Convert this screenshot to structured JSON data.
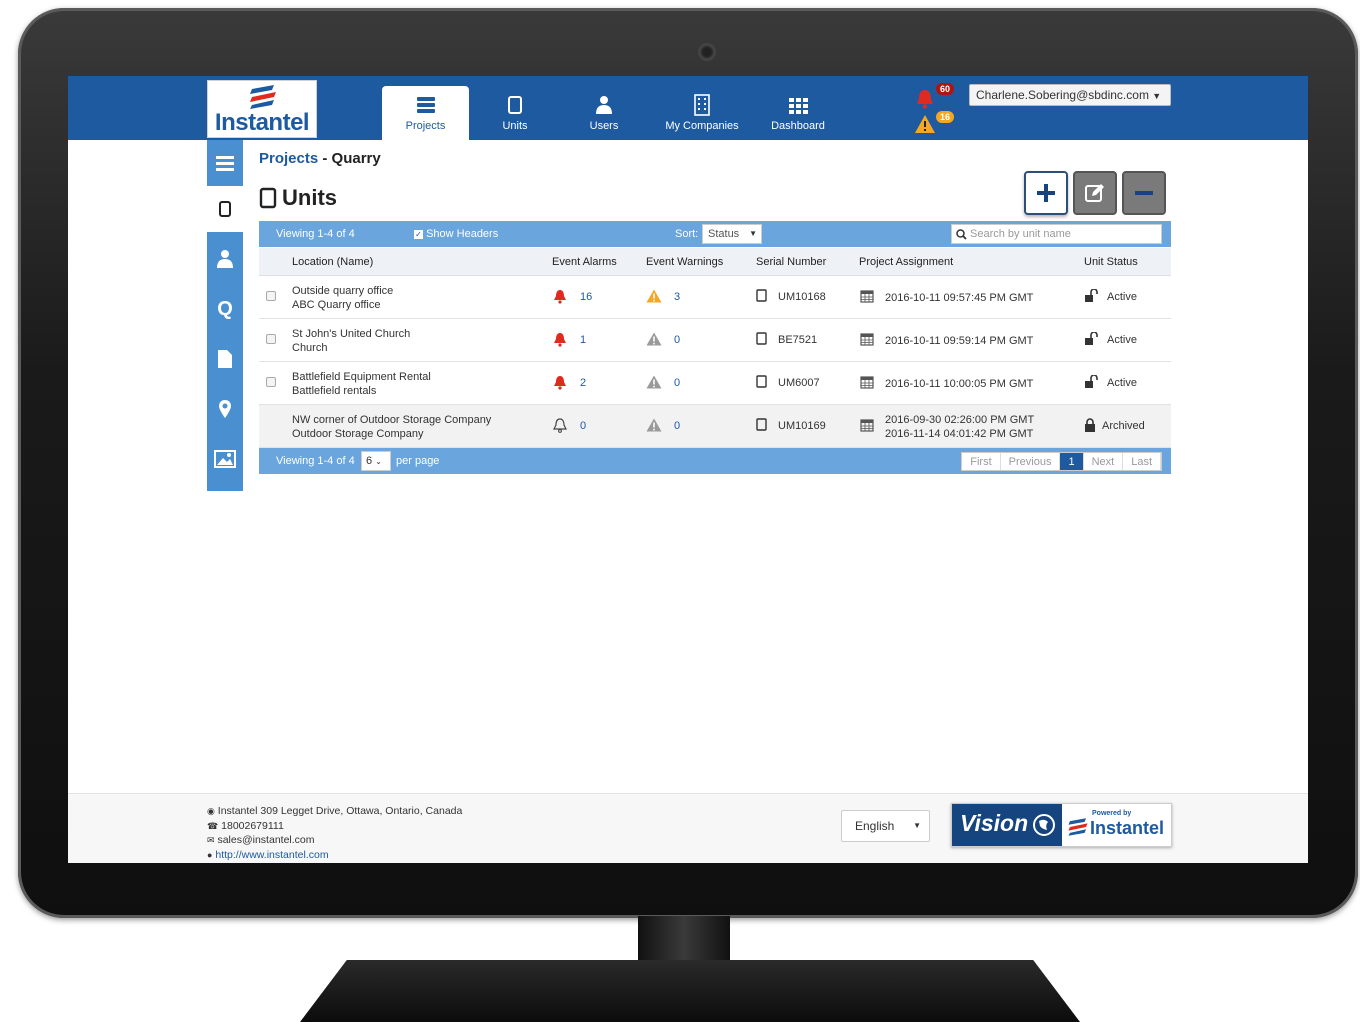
{
  "brand": {
    "logo_text": "Instantel"
  },
  "nav": [
    {
      "label": "Projects",
      "icon": "server-icon",
      "active": true
    },
    {
      "label": "Units",
      "icon": "tablet-icon"
    },
    {
      "label": "Users",
      "icon": "user-icon"
    },
    {
      "label": "My Companies",
      "icon": "building-icon"
    },
    {
      "label": "Dashboard",
      "icon": "grid-icon"
    }
  ],
  "alerts": {
    "alarm_count": "60",
    "warning_count": "16"
  },
  "user": {
    "email": "Charlene.Sobering@sbdinc.com"
  },
  "breadcrumb": {
    "parent": "Projects",
    "separator": "-",
    "current": "Quarry"
  },
  "page": {
    "title": "Units"
  },
  "toolbar": {
    "viewing": "Viewing 1-4 of 4",
    "show_headers": "Show Headers",
    "sort_label": "Sort:",
    "sort_value": "Status",
    "search_placeholder": "Search by unit name"
  },
  "table": {
    "headers": [
      "Location (Name)",
      "Event Alarms",
      "Event Warnings",
      "Serial Number",
      "Project Assignment",
      "Unit Status"
    ],
    "rows": [
      {
        "location": "Outside quarry office",
        "name": "ABC Quarry office",
        "alarms": "16",
        "warnings": "3",
        "serial": "UM10168",
        "assign1": "2016-10-11 09:57:45 PM GMT",
        "assign2": "",
        "status": "Active"
      },
      {
        "location": "St John's United Church",
        "name": "Church",
        "alarms": "1",
        "warnings": "0",
        "serial": "BE7521",
        "assign1": "2016-10-11 09:59:14 PM GMT",
        "assign2": "",
        "status": "Active"
      },
      {
        "location": "Battlefield Equipment Rental",
        "name": "Battlefield rentals",
        "alarms": "2",
        "warnings": "0",
        "serial": "UM6007",
        "assign1": "2016-10-11 10:00:05 PM GMT",
        "assign2": "",
        "status": "Active"
      },
      {
        "location": "NW corner of Outdoor Storage Company",
        "name": "Outdoor Storage Company",
        "alarms": "0",
        "warnings": "0",
        "serial": "UM10169",
        "assign1": "2016-09-30 02:26:00 PM GMT",
        "assign2": "2016-11-14 04:01:42 PM GMT",
        "status": "Archived"
      }
    ]
  },
  "footer_bar": {
    "viewing": "Viewing 1-4 of 4",
    "per_page_value": "6",
    "per_page_label": "per page",
    "pager": {
      "first": "First",
      "previous": "Previous",
      "current": "1",
      "next": "Next",
      "last": "Last"
    }
  },
  "footer": {
    "address": "Instantel 309 Legget Drive, Ottawa, Ontario, Canada",
    "phone": "18002679111",
    "email": "sales@instantel.com",
    "website": "http://www.instantel.com",
    "language": "English",
    "vision_text": "Vision",
    "powered_by": "Powered by",
    "powered_brand": "Instantel"
  },
  "colors": {
    "primary": "#1d5aa0",
    "rail": "#4a8fd0",
    "table_bar": "#6aa5dd",
    "alarm": "#e02a1f",
    "warning": "#f5a623"
  }
}
